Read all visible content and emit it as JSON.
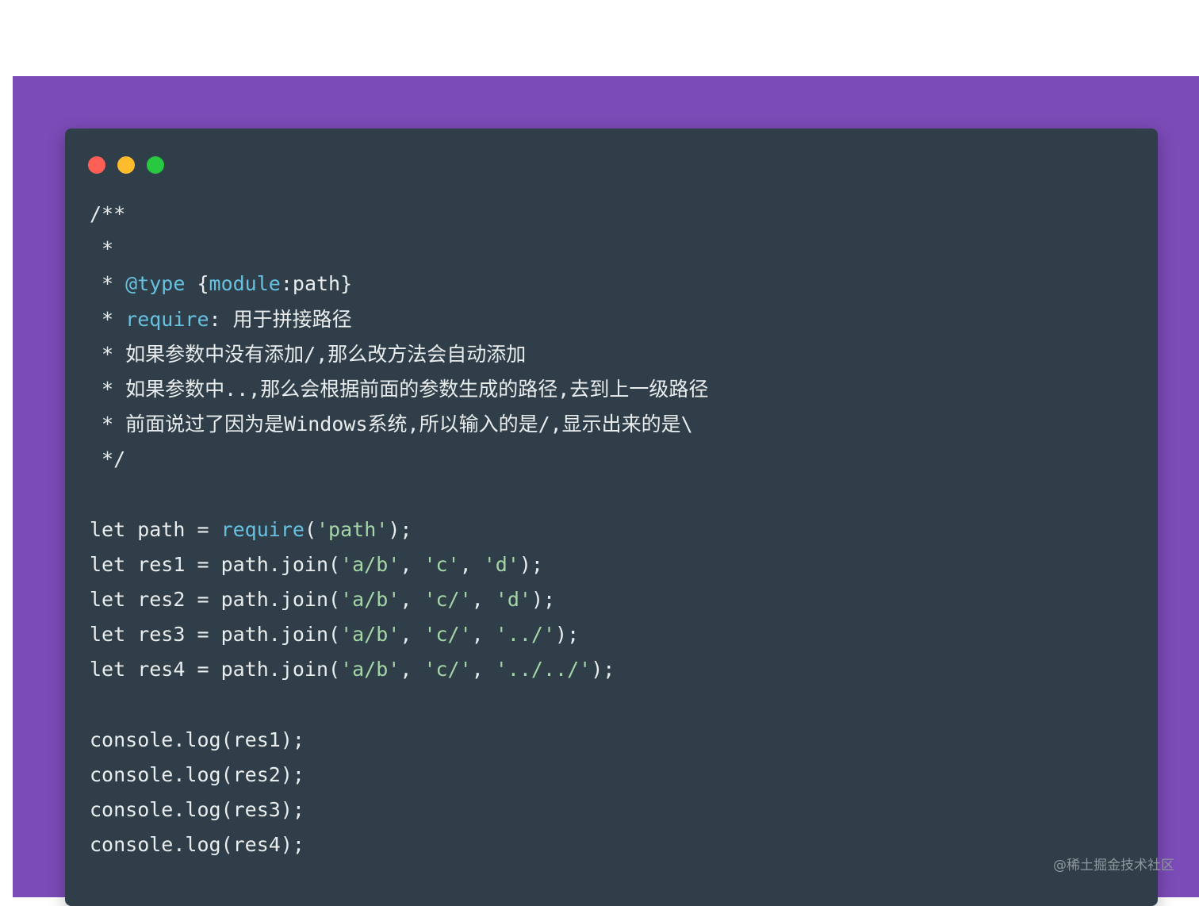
{
  "window": {
    "controls": [
      {
        "name": "close",
        "color": "#fd5f57"
      },
      {
        "name": "minimize",
        "color": "#fdbb2e"
      },
      {
        "name": "maximize",
        "color": "#28c840"
      }
    ]
  },
  "colors": {
    "background": "#7b4bb7",
    "editor": "#2f3e48",
    "text": "#e9edee",
    "keyword": "#67c1e0",
    "string": "#a5d6a7"
  },
  "code": {
    "lines": [
      [
        {
          "t": "/**",
          "k": "text"
        }
      ],
      [
        {
          "t": " *",
          "k": "text"
        }
      ],
      [
        {
          "t": " * ",
          "k": "text"
        },
        {
          "t": "@type",
          "k": "keyword"
        },
        {
          "t": " {",
          "k": "text"
        },
        {
          "t": "module",
          "k": "keyword"
        },
        {
          "t": ":path}",
          "k": "text"
        }
      ],
      [
        {
          "t": " * ",
          "k": "text"
        },
        {
          "t": "require",
          "k": "keyword"
        },
        {
          "t": ": 用于拼接路径",
          "k": "text"
        }
      ],
      [
        {
          "t": " * 如果参数中没有添加/,那么改方法会自动添加",
          "k": "text"
        }
      ],
      [
        {
          "t": " * 如果参数中..,那么会根据前面的参数生成的路径,去到上一级路径",
          "k": "text"
        }
      ],
      [
        {
          "t": " * 前面说过了因为是Windows系统,所以输入的是/,显示出来的是\\",
          "k": "text"
        }
      ],
      [
        {
          "t": " */",
          "k": "text"
        }
      ],
      [],
      [
        {
          "t": "let path = ",
          "k": "text"
        },
        {
          "t": "require",
          "k": "keyword"
        },
        {
          "t": "(",
          "k": "text"
        },
        {
          "t": "'path'",
          "k": "string"
        },
        {
          "t": ");",
          "k": "text"
        }
      ],
      [
        {
          "t": "let res1 = path.join(",
          "k": "text"
        },
        {
          "t": "'a/b'",
          "k": "string"
        },
        {
          "t": ", ",
          "k": "text"
        },
        {
          "t": "'c'",
          "k": "string"
        },
        {
          "t": ", ",
          "k": "text"
        },
        {
          "t": "'d'",
          "k": "string"
        },
        {
          "t": ");",
          "k": "text"
        }
      ],
      [
        {
          "t": "let res2 = path.join(",
          "k": "text"
        },
        {
          "t": "'a/b'",
          "k": "string"
        },
        {
          "t": ", ",
          "k": "text"
        },
        {
          "t": "'c/'",
          "k": "string"
        },
        {
          "t": ", ",
          "k": "text"
        },
        {
          "t": "'d'",
          "k": "string"
        },
        {
          "t": ");",
          "k": "text"
        }
      ],
      [
        {
          "t": "let res3 = path.join(",
          "k": "text"
        },
        {
          "t": "'a/b'",
          "k": "string"
        },
        {
          "t": ", ",
          "k": "text"
        },
        {
          "t": "'c/'",
          "k": "string"
        },
        {
          "t": ", ",
          "k": "text"
        },
        {
          "t": "'../'",
          "k": "string"
        },
        {
          "t": ");",
          "k": "text"
        }
      ],
      [
        {
          "t": "let res4 = path.join(",
          "k": "text"
        },
        {
          "t": "'a/b'",
          "k": "string"
        },
        {
          "t": ", ",
          "k": "text"
        },
        {
          "t": "'c/'",
          "k": "string"
        },
        {
          "t": ", ",
          "k": "text"
        },
        {
          "t": "'../../'",
          "k": "string"
        },
        {
          "t": ");",
          "k": "text"
        }
      ],
      [],
      [
        {
          "t": "console.log(res1);",
          "k": "text"
        }
      ],
      [
        {
          "t": "console.log(res2);",
          "k": "text"
        }
      ],
      [
        {
          "t": "console.log(res3);",
          "k": "text"
        }
      ],
      [
        {
          "t": "console.log(res4);",
          "k": "text"
        }
      ]
    ]
  },
  "watermark": "@稀土掘金技术社区"
}
